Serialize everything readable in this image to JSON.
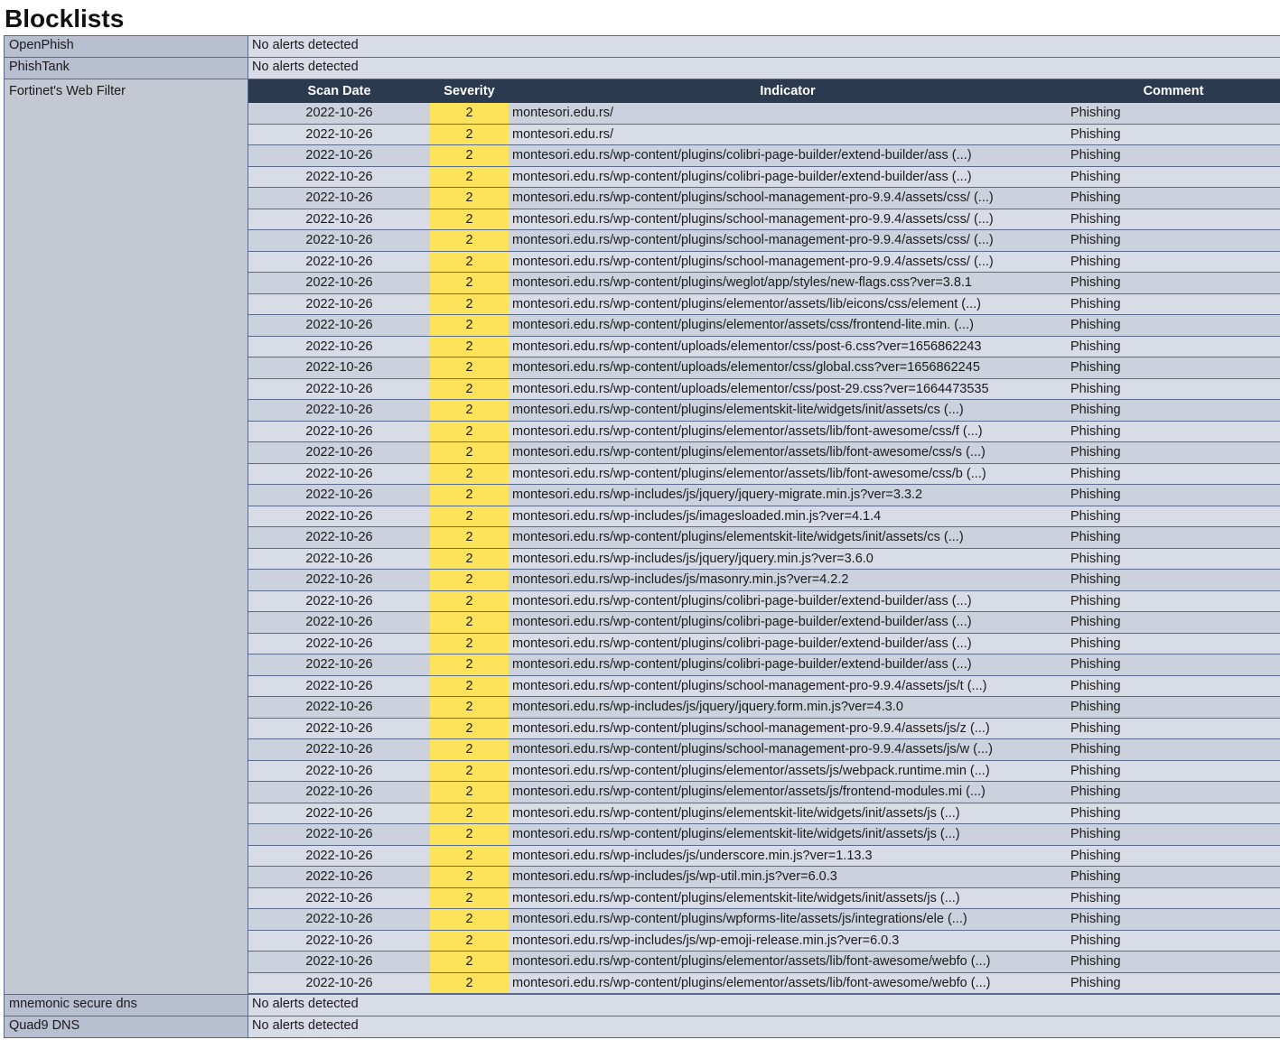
{
  "page": {
    "title": "Blocklists"
  },
  "columns": {
    "scan_date": "Scan Date",
    "severity": "Severity",
    "indicator": "Indicator",
    "comment": "Comment"
  },
  "simple_sources_top": [
    {
      "name": "OpenPhish",
      "result": "No alerts detected"
    },
    {
      "name": "PhishTank",
      "result": "No alerts detected"
    }
  ],
  "fortinet": {
    "name": "Fortinet's Web Filter",
    "rows": [
      {
        "date": "2022-10-26",
        "severity": "2",
        "indicator": "montesori.edu.rs/",
        "comment": "Phishing"
      },
      {
        "date": "2022-10-26",
        "severity": "2",
        "indicator": "montesori.edu.rs/",
        "comment": "Phishing"
      },
      {
        "date": "2022-10-26",
        "severity": "2",
        "indicator": "montesori.edu.rs/wp-content/plugins/colibri-page-builder/extend-builder/ass (...)",
        "comment": "Phishing"
      },
      {
        "date": "2022-10-26",
        "severity": "2",
        "indicator": "montesori.edu.rs/wp-content/plugins/colibri-page-builder/extend-builder/ass (...)",
        "comment": "Phishing"
      },
      {
        "date": "2022-10-26",
        "severity": "2",
        "indicator": "montesori.edu.rs/wp-content/plugins/school-management-pro-9.9.4/assets/css/ (...)",
        "comment": "Phishing"
      },
      {
        "date": "2022-10-26",
        "severity": "2",
        "indicator": "montesori.edu.rs/wp-content/plugins/school-management-pro-9.9.4/assets/css/ (...)",
        "comment": "Phishing"
      },
      {
        "date": "2022-10-26",
        "severity": "2",
        "indicator": "montesori.edu.rs/wp-content/plugins/school-management-pro-9.9.4/assets/css/ (...)",
        "comment": "Phishing"
      },
      {
        "date": "2022-10-26",
        "severity": "2",
        "indicator": "montesori.edu.rs/wp-content/plugins/school-management-pro-9.9.4/assets/css/ (...)",
        "comment": "Phishing"
      },
      {
        "date": "2022-10-26",
        "severity": "2",
        "indicator": "montesori.edu.rs/wp-content/plugins/weglot/app/styles/new-flags.css?ver=3.8.1",
        "comment": "Phishing"
      },
      {
        "date": "2022-10-26",
        "severity": "2",
        "indicator": "montesori.edu.rs/wp-content/plugins/elementor/assets/lib/eicons/css/element (...)",
        "comment": "Phishing"
      },
      {
        "date": "2022-10-26",
        "severity": "2",
        "indicator": "montesori.edu.rs/wp-content/plugins/elementor/assets/css/frontend-lite.min. (...)",
        "comment": "Phishing"
      },
      {
        "date": "2022-10-26",
        "severity": "2",
        "indicator": "montesori.edu.rs/wp-content/uploads/elementor/css/post-6.css?ver=1656862243",
        "comment": "Phishing"
      },
      {
        "date": "2022-10-26",
        "severity": "2",
        "indicator": "montesori.edu.rs/wp-content/uploads/elementor/css/global.css?ver=1656862245",
        "comment": "Phishing"
      },
      {
        "date": "2022-10-26",
        "severity": "2",
        "indicator": "montesori.edu.rs/wp-content/uploads/elementor/css/post-29.css?ver=1664473535",
        "comment": "Phishing"
      },
      {
        "date": "2022-10-26",
        "severity": "2",
        "indicator": "montesori.edu.rs/wp-content/plugins/elementskit-lite/widgets/init/assets/cs (...)",
        "comment": "Phishing"
      },
      {
        "date": "2022-10-26",
        "severity": "2",
        "indicator": "montesori.edu.rs/wp-content/plugins/elementor/assets/lib/font-awesome/css/f (...)",
        "comment": "Phishing"
      },
      {
        "date": "2022-10-26",
        "severity": "2",
        "indicator": "montesori.edu.rs/wp-content/plugins/elementor/assets/lib/font-awesome/css/s (...)",
        "comment": "Phishing"
      },
      {
        "date": "2022-10-26",
        "severity": "2",
        "indicator": "montesori.edu.rs/wp-content/plugins/elementor/assets/lib/font-awesome/css/b (...)",
        "comment": "Phishing"
      },
      {
        "date": "2022-10-26",
        "severity": "2",
        "indicator": "montesori.edu.rs/wp-includes/js/jquery/jquery-migrate.min.js?ver=3.3.2",
        "comment": "Phishing"
      },
      {
        "date": "2022-10-26",
        "severity": "2",
        "indicator": "montesori.edu.rs/wp-includes/js/imagesloaded.min.js?ver=4.1.4",
        "comment": "Phishing"
      },
      {
        "date": "2022-10-26",
        "severity": "2",
        "indicator": "montesori.edu.rs/wp-content/plugins/elementskit-lite/widgets/init/assets/cs (...)",
        "comment": "Phishing"
      },
      {
        "date": "2022-10-26",
        "severity": "2",
        "indicator": "montesori.edu.rs/wp-includes/js/jquery/jquery.min.js?ver=3.6.0",
        "comment": "Phishing"
      },
      {
        "date": "2022-10-26",
        "severity": "2",
        "indicator": "montesori.edu.rs/wp-includes/js/masonry.min.js?ver=4.2.2",
        "comment": "Phishing"
      },
      {
        "date": "2022-10-26",
        "severity": "2",
        "indicator": "montesori.edu.rs/wp-content/plugins/colibri-page-builder/extend-builder/ass (...)",
        "comment": "Phishing"
      },
      {
        "date": "2022-10-26",
        "severity": "2",
        "indicator": "montesori.edu.rs/wp-content/plugins/colibri-page-builder/extend-builder/ass (...)",
        "comment": "Phishing"
      },
      {
        "date": "2022-10-26",
        "severity": "2",
        "indicator": "montesori.edu.rs/wp-content/plugins/colibri-page-builder/extend-builder/ass (...)",
        "comment": "Phishing"
      },
      {
        "date": "2022-10-26",
        "severity": "2",
        "indicator": "montesori.edu.rs/wp-content/plugins/colibri-page-builder/extend-builder/ass (...)",
        "comment": "Phishing"
      },
      {
        "date": "2022-10-26",
        "severity": "2",
        "indicator": "montesori.edu.rs/wp-content/plugins/school-management-pro-9.9.4/assets/js/t (...)",
        "comment": "Phishing"
      },
      {
        "date": "2022-10-26",
        "severity": "2",
        "indicator": "montesori.edu.rs/wp-includes/js/jquery/jquery.form.min.js?ver=4.3.0",
        "comment": "Phishing"
      },
      {
        "date": "2022-10-26",
        "severity": "2",
        "indicator": "montesori.edu.rs/wp-content/plugins/school-management-pro-9.9.4/assets/js/z (...)",
        "comment": "Phishing"
      },
      {
        "date": "2022-10-26",
        "severity": "2",
        "indicator": "montesori.edu.rs/wp-content/plugins/school-management-pro-9.9.4/assets/js/w (...)",
        "comment": "Phishing"
      },
      {
        "date": "2022-10-26",
        "severity": "2",
        "indicator": "montesori.edu.rs/wp-content/plugins/elementor/assets/js/webpack.runtime.min (...)",
        "comment": "Phishing"
      },
      {
        "date": "2022-10-26",
        "severity": "2",
        "indicator": "montesori.edu.rs/wp-content/plugins/elementor/assets/js/frontend-modules.mi (...)",
        "comment": "Phishing"
      },
      {
        "date": "2022-10-26",
        "severity": "2",
        "indicator": "montesori.edu.rs/wp-content/plugins/elementskit-lite/widgets/init/assets/js (...)",
        "comment": "Phishing"
      },
      {
        "date": "2022-10-26",
        "severity": "2",
        "indicator": "montesori.edu.rs/wp-content/plugins/elementskit-lite/widgets/init/assets/js (...)",
        "comment": "Phishing"
      },
      {
        "date": "2022-10-26",
        "severity": "2",
        "indicator": "montesori.edu.rs/wp-includes/js/underscore.min.js?ver=1.13.3",
        "comment": "Phishing"
      },
      {
        "date": "2022-10-26",
        "severity": "2",
        "indicator": "montesori.edu.rs/wp-includes/js/wp-util.min.js?ver=6.0.3",
        "comment": "Phishing"
      },
      {
        "date": "2022-10-26",
        "severity": "2",
        "indicator": "montesori.edu.rs/wp-content/plugins/elementskit-lite/widgets/init/assets/js (...)",
        "comment": "Phishing"
      },
      {
        "date": "2022-10-26",
        "severity": "2",
        "indicator": "montesori.edu.rs/wp-content/plugins/wpforms-lite/assets/js/integrations/ele (...)",
        "comment": "Phishing"
      },
      {
        "date": "2022-10-26",
        "severity": "2",
        "indicator": "montesori.edu.rs/wp-includes/js/wp-emoji-release.min.js?ver=6.0.3",
        "comment": "Phishing"
      },
      {
        "date": "2022-10-26",
        "severity": "2",
        "indicator": "montesori.edu.rs/wp-content/plugins/elementor/assets/lib/font-awesome/webfo (...)",
        "comment": "Phishing"
      },
      {
        "date": "2022-10-26",
        "severity": "2",
        "indicator": "montesori.edu.rs/wp-content/plugins/elementor/assets/lib/font-awesome/webfo (...)",
        "comment": "Phishing"
      }
    ]
  },
  "simple_sources_bottom": [
    {
      "name": "mnemonic secure dns",
      "result": "No alerts detected"
    },
    {
      "name": "Quad9 DNS",
      "result": "No alerts detected"
    }
  ],
  "colors": {
    "header_bg": "#2c3a50",
    "severity_bg": "#fde35a",
    "source_bg": "#b8bfd0",
    "cell_bg": "#d8dce6"
  }
}
